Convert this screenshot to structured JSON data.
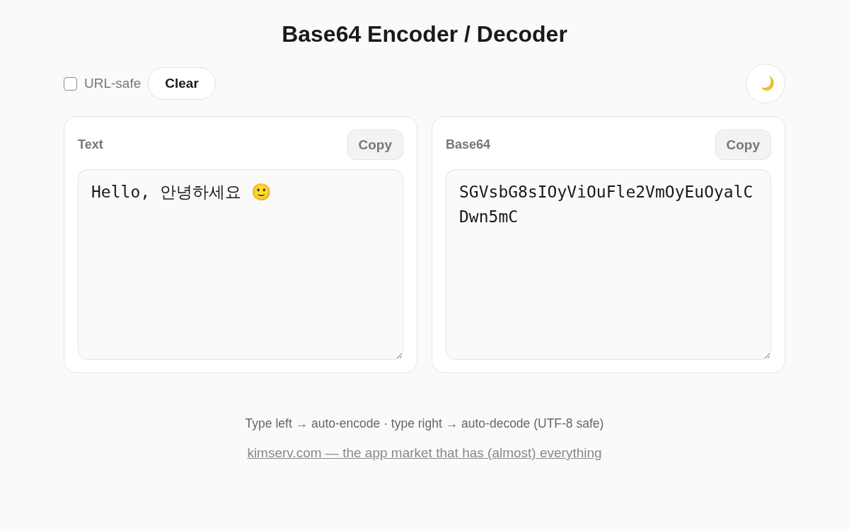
{
  "title": "Base64 Encoder / Decoder",
  "toolbar": {
    "url_safe": {
      "label": "URL-safe",
      "checked": false
    },
    "clear_button": "Clear"
  },
  "panels": [
    {
      "label": "Text",
      "copy_button": "Copy",
      "value": "Hello, 안녕하세요 🙂"
    },
    {
      "label": "Base64",
      "copy_button": "Copy",
      "value": "SGVsbG8sIOyViOuFle2VmOyEuOyalCDwn5mC"
    }
  ],
  "footer": {
    "hint": "Type left → auto-encode · type right → auto-decode (UTF-8 safe)",
    "link": "kimserv.com — the app market that has (almost) everything"
  }
}
